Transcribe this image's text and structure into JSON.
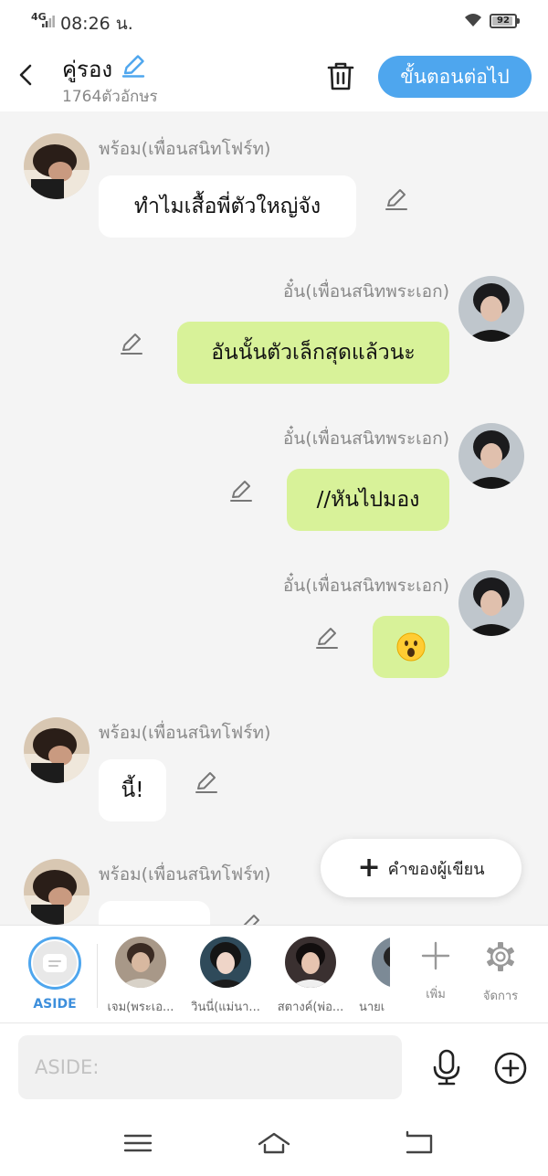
{
  "status": {
    "network": "4G",
    "time": "08:26 น.",
    "battery": "92",
    "battery_level": 0.92
  },
  "header": {
    "title": "คู่รอง",
    "subtitle": "1764ตัวอักษร",
    "next_label": "ขั้นตอนต่อไป"
  },
  "messages": [
    {
      "sender": "พร้อม(เพื่อนสนิทโฟร์ท)",
      "text": "ทำไมเสื้อพี่ตัวใหญ่จัง",
      "side": "left"
    },
    {
      "sender": "อั๋น(เพื่อนสนิทพระเอก)",
      "text": "อันนั้นตัวเล็กสุดแล้วนะ",
      "side": "right"
    },
    {
      "sender": "อั๋น(เพื่อนสนิทพระเอก)",
      "text": "//หันไปมอง",
      "side": "right"
    },
    {
      "sender": "อั๋น(เพื่อนสนิทพระเอก)",
      "text": "😮",
      "side": "right"
    },
    {
      "sender": "พร้อม(เพื่อนสนิทโฟร์ท)",
      "text": "นี้!",
      "side": "left"
    },
    {
      "sender": "พร้อม(เพื่อนสนิทโฟร์ท)",
      "text": "",
      "side": "left"
    }
  ],
  "fab": {
    "label": "คำของผู้เขียน"
  },
  "characters": {
    "aside_label": "ASIDE",
    "items": [
      {
        "name": "เจม(พระเอ..."
      },
      {
        "name": "วินนี่(แม่นา..."
      },
      {
        "name": "สตางค์(พ่อ..."
      },
      {
        "name": "นายเ"
      }
    ],
    "add_label": "เพิ่ม",
    "manage_label": "จัดการ"
  },
  "input": {
    "placeholder": "ASIDE:"
  },
  "colors": {
    "accent": "#4ea6ee",
    "bubble_right": "#d8f299",
    "bubble_left": "#ffffff",
    "background": "#f4f4f4"
  }
}
